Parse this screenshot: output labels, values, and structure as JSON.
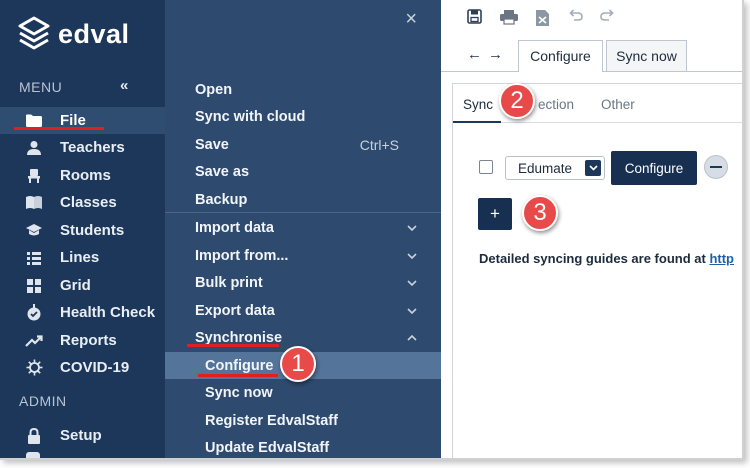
{
  "app": {
    "logo_text": "edval"
  },
  "sidebar": {
    "menu_heading": "MENU",
    "collapse_icon": "«",
    "admin_heading": "ADMIN",
    "items": [
      {
        "label": "File",
        "icon": "folder-icon"
      },
      {
        "label": "Teachers",
        "icon": "person-icon"
      },
      {
        "label": "Rooms",
        "icon": "chair-icon"
      },
      {
        "label": "Classes",
        "icon": "book-icon"
      },
      {
        "label": "Students",
        "icon": "graduation-cap-icon"
      },
      {
        "label": "Lines",
        "icon": "lines-icon"
      },
      {
        "label": "Grid",
        "icon": "grid-icon"
      },
      {
        "label": "Health Check",
        "icon": "health-check-icon"
      },
      {
        "label": "Reports",
        "icon": "trend-icon"
      },
      {
        "label": "COVID-19",
        "icon": "virus-icon"
      }
    ],
    "admin_items": [
      {
        "label": "Setup",
        "icon": "lock-icon"
      }
    ]
  },
  "file_menu": {
    "close_icon": "×",
    "items": [
      {
        "label": "Open"
      },
      {
        "label": "Sync with cloud"
      },
      {
        "label": "Save",
        "shortcut": "Ctrl+S"
      },
      {
        "label": "Save as"
      },
      {
        "label": "Backup"
      },
      {
        "label": "Import data"
      },
      {
        "label": "Import from..."
      },
      {
        "label": "Bulk print"
      },
      {
        "label": "Export data"
      },
      {
        "label": "Synchronise"
      },
      {
        "label": "Configure"
      },
      {
        "label": "Sync now"
      },
      {
        "label": "Register EdvalStaff"
      },
      {
        "label": "Update EdvalStaff"
      }
    ]
  },
  "toolbar": {
    "icons": [
      "save-icon",
      "print-icon",
      "export-icon",
      "undo-icon",
      "redo-icon"
    ],
    "back": "←",
    "forward": "→"
  },
  "tabs": [
    {
      "label": "Configure",
      "active": true
    },
    {
      "label": "Sync now",
      "active": false
    }
  ],
  "subtabs": [
    {
      "label": "Sync",
      "active": true
    },
    {
      "label": "ection"
    },
    {
      "label": "Other"
    }
  ],
  "sync_row": {
    "source_value": "Edumate",
    "configure_label": "Configure",
    "add_label": "+"
  },
  "guide": {
    "text": "Detailed syncing guides are found at ",
    "link_text": "http"
  },
  "callouts": [
    "1",
    "2",
    "3"
  ],
  "colors": {
    "sidebar_bg": "#1c3759",
    "panel_bg": "#2e4a6e",
    "highlight": "#557499",
    "callout": "#e84a4a",
    "accent_red": "#e02020"
  }
}
